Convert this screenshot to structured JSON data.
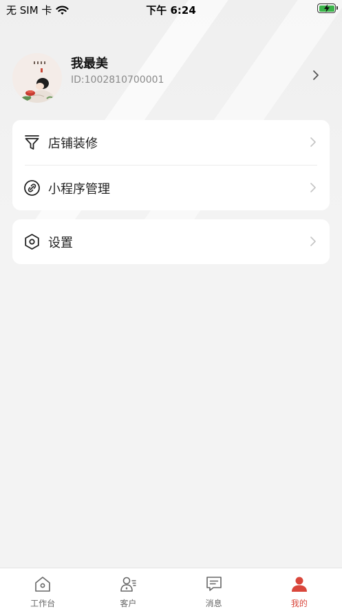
{
  "status_bar": {
    "carrier": "无 SIM 卡",
    "time": "下午 6:24",
    "wifi_icon": "wifi-icon",
    "battery_icon": "battery-charging-icon",
    "battery_level": 1.0
  },
  "profile": {
    "name": "我最美",
    "id_text": "ID:1002810700001",
    "avatar_icon": "avatar-illustration"
  },
  "menu_groups": [
    {
      "items": [
        {
          "label": "店铺装修",
          "icon": "funnel-icon"
        },
        {
          "label": "小程序管理",
          "icon": "link-circle-icon"
        }
      ]
    },
    {
      "items": [
        {
          "label": "设置",
          "icon": "hexagon-settings-icon"
        }
      ]
    }
  ],
  "tab_bar": {
    "tabs": [
      {
        "label": "工作台",
        "icon": "home-icon",
        "active": false
      },
      {
        "label": "客户",
        "icon": "customer-icon",
        "active": false
      },
      {
        "label": "消息",
        "icon": "message-icon",
        "active": false
      },
      {
        "label": "我的",
        "icon": "profile-icon",
        "active": true
      }
    ]
  },
  "colors": {
    "accent": "#d9463b",
    "background": "#f3f3f3",
    "card": "#ffffff",
    "text_secondary": "#8a8a8a"
  }
}
